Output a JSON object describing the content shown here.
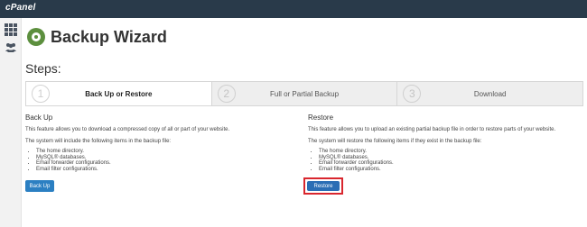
{
  "app": {
    "logo": "cPanel"
  },
  "page": {
    "title": "Backup Wizard",
    "steps_heading": "Steps:"
  },
  "steps": [
    {
      "number": "1",
      "label": "Back Up or Restore"
    },
    {
      "number": "2",
      "label": "Full or Partial Backup"
    },
    {
      "number": "3",
      "label": "Download"
    }
  ],
  "backup": {
    "title": "Back Up",
    "description": "This feature allows you to download a compressed copy of all or part of your website.",
    "intro": "The system will include the following items in the backup file:",
    "items": [
      "The home directory.",
      "MySQL® databases.",
      "Email forwarder configurations.",
      "Email filter configurations."
    ],
    "button": "Back Up"
  },
  "restore": {
    "title": "Restore",
    "description": "This feature allows you to upload an existing partial backup file in order to restore parts of your website.",
    "intro": "The system will restore the following items if they exist in the backup file:",
    "items": [
      "The home directory.",
      "MySQL® databases.",
      "Email forwarder configurations.",
      "Email filter configurations."
    ],
    "button": "Restore"
  },
  "colors": {
    "topbar": "#293a4a",
    "button": "#2b7fc2",
    "highlight": "#d9262e"
  }
}
